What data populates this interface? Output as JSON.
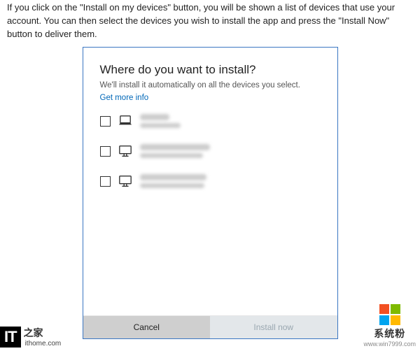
{
  "intro": "If you click on the \"Install on my devices\" button, you will be shown a list of devices that use your account. You can then select the devices you wish to install the app and press the \"Install Now\" button to deliver them.",
  "dialog": {
    "title": "Where do you want to install?",
    "subtitle": "We'll install it automatically on all the devices you select.",
    "link": "Get more info",
    "devices": [
      {
        "type": "laptop"
      },
      {
        "type": "desktop"
      },
      {
        "type": "desktop"
      }
    ],
    "buttons": {
      "cancel": "Cancel",
      "install": "Install now"
    }
  },
  "watermark_left": {
    "logo_text": "IT",
    "site": "ithome.com"
  },
  "watermark_right": {
    "label": "系统粉",
    "url": "www.win7999.com"
  }
}
